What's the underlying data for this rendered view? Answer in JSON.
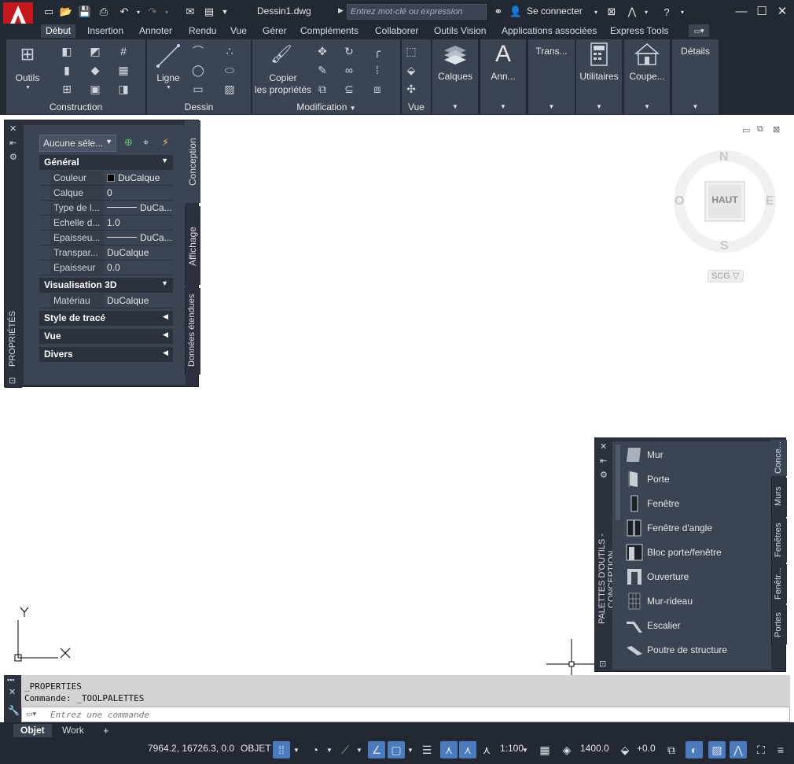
{
  "title_bar": {
    "doc_title": "Dessin1.dwg",
    "search_placeholder": "Entrez mot-clé ou expression",
    "signin_label": "Se connecter"
  },
  "tabs": [
    {
      "label": "Début",
      "active": true
    },
    {
      "label": "Insertion"
    },
    {
      "label": "Annoter"
    },
    {
      "label": "Rendu"
    },
    {
      "label": "Vue"
    },
    {
      "label": "Gérer"
    },
    {
      "label": "Compléments"
    },
    {
      "label": "Collaborer"
    },
    {
      "label": "Outils Vision"
    },
    {
      "label": "Applications associées"
    },
    {
      "label": "Express Tools"
    }
  ],
  "ribbon": {
    "outils_label": "Outils",
    "ligne_label": "Ligne",
    "copier_label_1": "Copier",
    "copier_label_2": "les propriétés",
    "calques_label": "Calques",
    "ann_label": "Ann...",
    "trans_label": "Trans...",
    "utilitaires_label": "Utilitaires",
    "coupe_label": "Coupe...",
    "details_label": "Détails",
    "panel_construction": "Construction",
    "panel_dessin": "Dessin",
    "panel_modification": "Modification",
    "panel_vue": "Vue"
  },
  "properties": {
    "selection": "Aucune séle...",
    "general_header": "Général",
    "rows": [
      {
        "key": "Couleur",
        "value": "DuCalque"
      },
      {
        "key": "Calque",
        "value": "0"
      },
      {
        "key": "Type de l...",
        "value": "DuCa..."
      },
      {
        "key": "Echelle d...",
        "value": "1.0"
      },
      {
        "key": "Epaisseu...",
        "value": "DuCa..."
      },
      {
        "key": "Transpar...",
        "value": "DuCalque"
      },
      {
        "key": "Epaisseur",
        "value": "0.0"
      }
    ],
    "vis3d_header": "Visualisation 3D",
    "materiau_key": "Matériau",
    "materiau_value": "DuCalque",
    "style_header": "Style de tracé",
    "vue_header": "Vue",
    "divers_header": "Divers",
    "side_title": "PROPRIÉTÉS",
    "tab_conception": "Conception",
    "tab_affichage": "Affichage",
    "tab_donnees": "Données étendues"
  },
  "viewcube": {
    "n": "N",
    "s": "S",
    "e": "E",
    "o": "O",
    "face": "HAUT",
    "ucs": "SCG"
  },
  "tool_palette": {
    "side_title": "PALETTES D'OUTILS - CONCEPTION",
    "items": [
      "Mur",
      "Porte",
      "Fenêtre",
      "Fenêtre d'angle",
      "Bloc porte/fenêtre",
      "Ouverture",
      "Mur-rideau",
      "Escalier",
      "Poutre de structure"
    ],
    "tabs": [
      "Conce...",
      "Murs",
      "Fenêtres",
      "Fenêtr...",
      "Portes"
    ]
  },
  "command": {
    "history_1": "_PROPERTIES",
    "history_2": "Commande: _TOOLPALETTES",
    "placeholder": "Entrez une commande"
  },
  "layout_tabs": {
    "objet": "Objet",
    "work": "Work",
    "add": "+"
  },
  "status": {
    "coords": "7964.2, 16726.3, 0.0",
    "mode": "OBJET",
    "scale": "1:100",
    "elevation": "1400.0",
    "offset": "+0.0"
  },
  "ucs_axes": {
    "x": "X",
    "y": "Y"
  }
}
